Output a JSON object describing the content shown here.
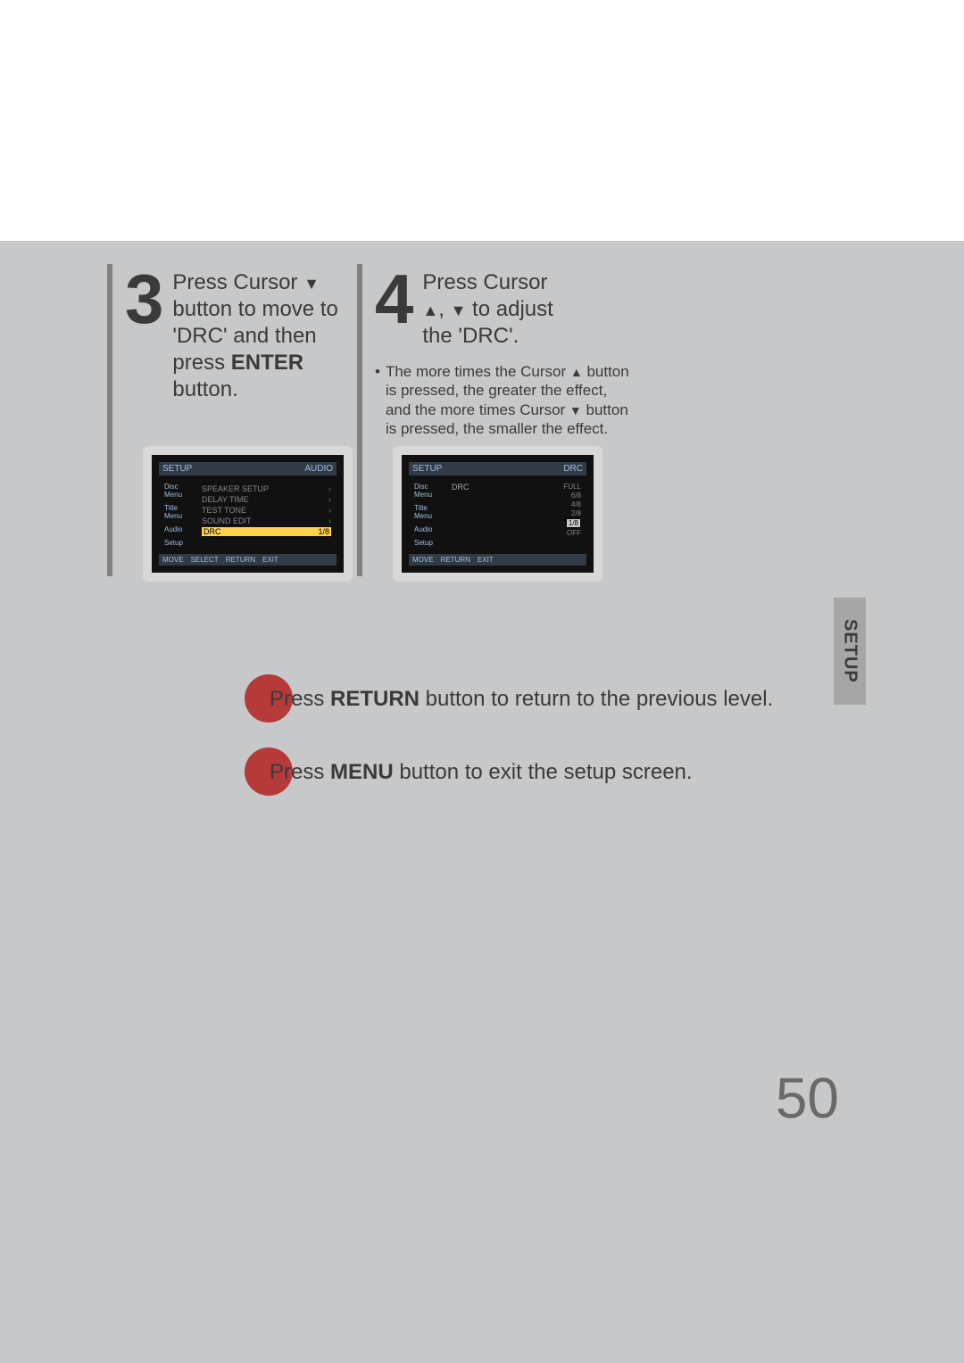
{
  "sideTab": "SETUP",
  "pageNumber": "50",
  "step3": {
    "num": "3",
    "line1a": "Press Cursor ",
    "line2": "button to move to",
    "line3": "'DRC' and then",
    "line4a": "press ",
    "line4b": "ENTER",
    "line5": "button."
  },
  "step4": {
    "num": "4",
    "line1": "Press Cursor",
    "line2b": " to adjust",
    "line3": "the 'DRC'."
  },
  "note4": {
    "t1": "The more times the Cursor ",
    "t2": " button is pressed, the greater the effect, and the more times Cursor ",
    "t3": " button is pressed, the smaller the effect."
  },
  "returnInstr": {
    "a": "Press ",
    "b": "RETURN",
    "c": " button to return to the previous level."
  },
  "menuInstr": {
    "a": "Press ",
    "b": "MENU",
    "c": " button to exit the setup screen."
  },
  "screen3": {
    "titleLeft": "SETUP",
    "titleRight": "AUDIO",
    "sideLabels": [
      "Disc Menu",
      "Title Menu",
      "Audio",
      "Setup"
    ],
    "rows": [
      {
        "label": "SPEAKER SETUP",
        "val": ""
      },
      {
        "label": "DELAY TIME",
        "val": ""
      },
      {
        "label": "TEST TONE",
        "val": ""
      },
      {
        "label": "SOUND EDIT",
        "val": ""
      },
      {
        "label": "DRC",
        "val": "1/8",
        "selected": true
      }
    ],
    "footer": [
      "MOVE",
      "SELECT",
      "RETURN",
      "EXIT"
    ]
  },
  "screen4": {
    "titleLeft": "SETUP",
    "titleRight": "DRC",
    "sideLabels": [
      "Disc Menu",
      "Title Menu",
      "Audio",
      "Setup"
    ],
    "drcLabel": "DRC",
    "scale": [
      "FULL",
      "6/8",
      "4/8",
      "2/8",
      "1/8",
      "OFF"
    ],
    "footer": [
      "MOVE",
      "RETURN",
      "EXIT"
    ]
  }
}
